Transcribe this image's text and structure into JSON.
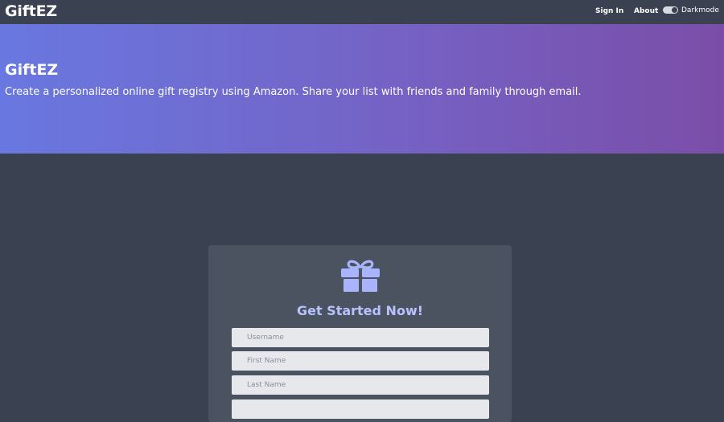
{
  "navbar": {
    "brand": "GiftEZ",
    "sign_in": "Sign In",
    "about": "About",
    "darkmode_label": "Darkmode"
  },
  "hero": {
    "title": "GiftEZ",
    "subtitle": "Create a personalized online gift registry using Amazon. Share your list with friends and family through email."
  },
  "signup_card": {
    "icon": "gift-icon",
    "title": "Get Started Now!",
    "fields": [
      {
        "placeholder": "Username",
        "value": ""
      },
      {
        "placeholder": "First Name",
        "value": ""
      },
      {
        "placeholder": "Last Name",
        "value": ""
      },
      {
        "placeholder": "",
        "value": ""
      }
    ]
  },
  "colors": {
    "background": "#3a4150",
    "hero_gradient_start": "#6978e0",
    "hero_gradient_end": "#7a4ea8",
    "card": "#4b5260",
    "accent": "#b8c2ff",
    "icon": "#a9b4ff"
  }
}
